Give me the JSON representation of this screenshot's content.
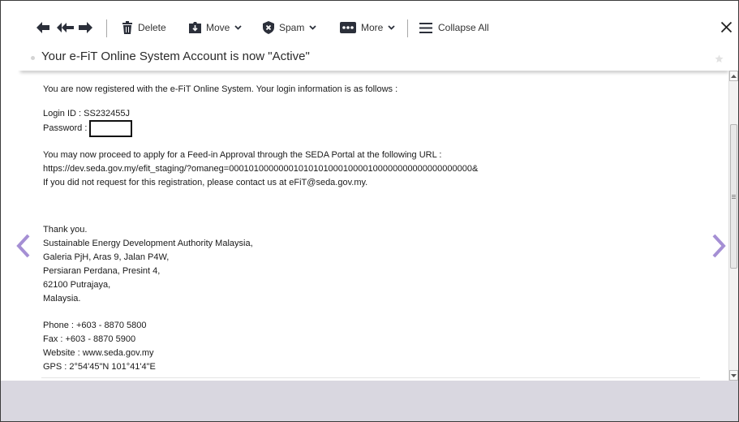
{
  "colors": {
    "accent": "#a58fd4",
    "page_background": "#d9d7e0",
    "text": "#1a1a1a",
    "toolbar_text": "#333333"
  },
  "icons": {
    "back": "arrow-left-icon",
    "back_all": "double-arrow-left-icon",
    "forward": "arrow-right-icon",
    "delete": "trash-icon",
    "move": "move-folder-icon",
    "spam": "shield-icon",
    "more": "more-dots-icon",
    "collapse": "collapse-lines-icon",
    "dropdown": "chevron-down-icon",
    "close": "close-icon",
    "star": "star-icon",
    "previous": "chevron-left-icon",
    "next": "chevron-right-icon",
    "scroll_up": "triangle-up-icon",
    "scroll_down": "triangle-down-icon",
    "scroll_grip": "grip-lines-icon"
  },
  "toolbar": {
    "delete_label": "Delete",
    "move_label": "Move",
    "spam_label": "Spam",
    "more_label": "More",
    "collapse_label": "Collapse All"
  },
  "message": {
    "subject": "Your e-FiT Online System Account is now \"Active\"",
    "intro": "You are now registered with the e-FiT Online System. Your login information is as follows :",
    "login_id": "Login ID : SS232455J",
    "password_label": "Password :",
    "proceed": "You may now proceed to apply for a Feed-in Approval through the SEDA Portal at the following URL :",
    "url": "https://dev.seda.gov.my/efit_staging/?omaneg=0001010000000101010100010000100000000000000000000&",
    "contact": "If you did not request for this registration, please contact us at eFiT@seda.gov.my.",
    "signature": [
      "Thank you.",
      "Sustainable Energy Development Authority Malaysia,",
      "Galeria PjH, Aras 9, Jalan P4W,",
      "Persiaran Perdana, Presint 4,",
      "62100 Putrajaya,",
      "Malaysia."
    ],
    "contact_details": [
      "Phone : +603 - 8870 5800",
      "Fax : +603 - 8870 5900",
      "Website : www.seda.gov.my",
      "GPS : 2°54'45\"N 101°41'4\"E"
    ]
  }
}
